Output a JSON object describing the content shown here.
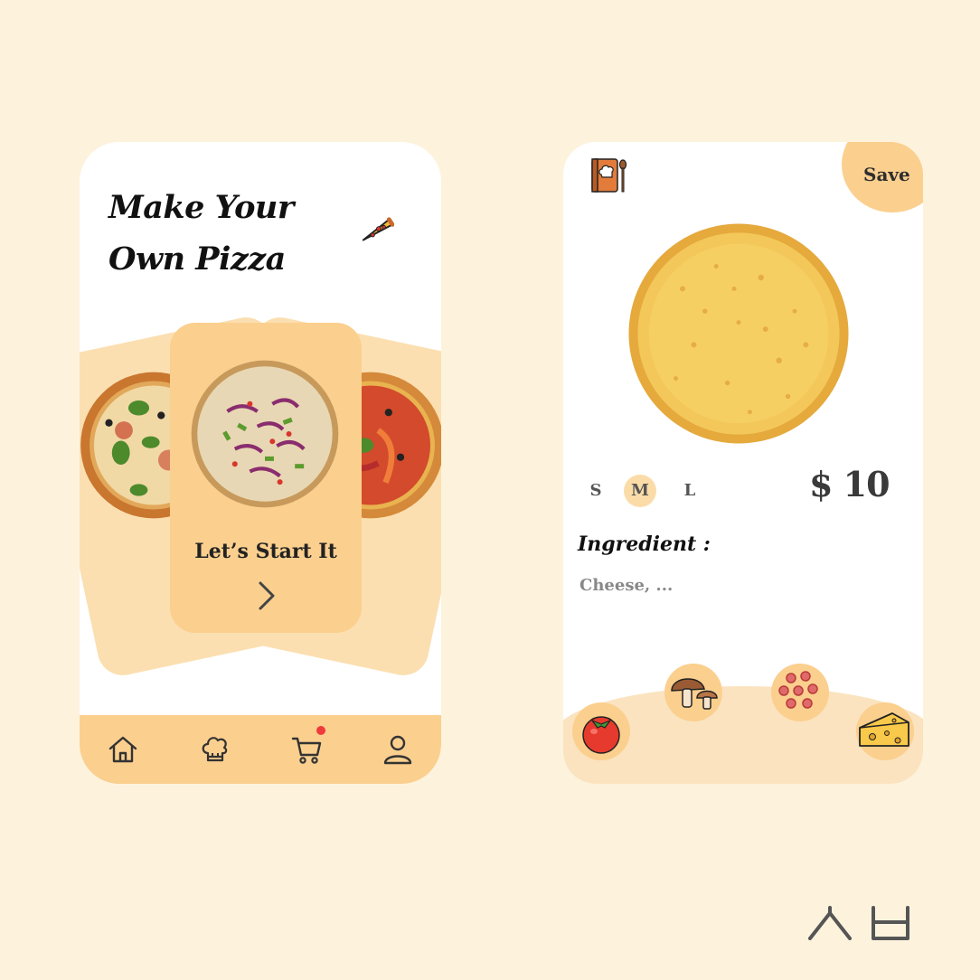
{
  "builder_screen": {
    "title_line1": "Make Your",
    "title_line2": "Own Pizza",
    "card_label": "Let’s Start It",
    "nav": {
      "items": [
        "home-icon",
        "chef-hat-icon",
        "cart-icon",
        "profile-icon"
      ],
      "cart_badge": "red-dot"
    }
  },
  "detail_screen": {
    "save_label": "Save",
    "sizes": [
      "S",
      "M",
      "L"
    ],
    "selected_size": "M",
    "price": "$ 10",
    "ingredient_heading": "Ingredient :",
    "ingredient_value": "Cheese, ...",
    "toppings": [
      "tomato-icon",
      "mushroom-icon",
      "pepperoni-icon",
      "cheese-icon"
    ]
  },
  "colors": {
    "background": "#fdf3dd",
    "accent": "#fbcf8e",
    "accent_light": "#fbdfb0"
  }
}
